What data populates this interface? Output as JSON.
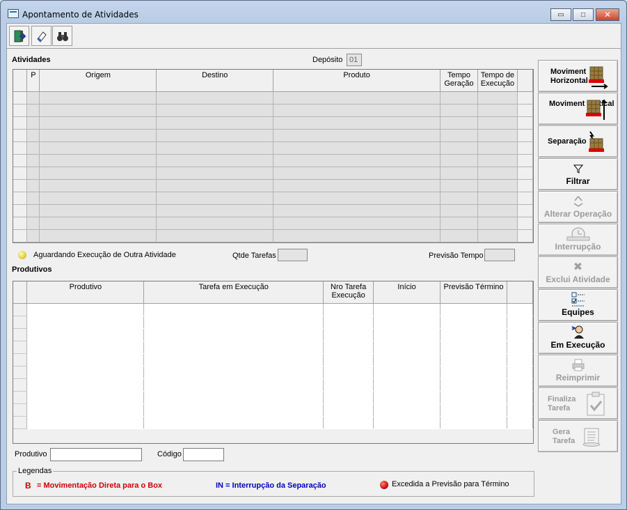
{
  "window": {
    "title": "Apontamento de Atividades",
    "minimize": "▭",
    "maximize": "□",
    "close": "✕"
  },
  "toolbar": {
    "buttons": [
      {
        "icon": "exit-door-icon"
      },
      {
        "icon": "eraser-icon"
      },
      {
        "icon": "binoculars-icon"
      }
    ]
  },
  "atividades": {
    "section_title": "Atividades",
    "deposito_label": "Depósito",
    "deposito_value": "01",
    "columns": [
      "",
      "P",
      "Origem",
      "Destino",
      "Produto",
      "Tempo Geração",
      "Tempo de Execução"
    ],
    "row_count": 12,
    "status_text": "Aguardando Execução de Outra Atividade",
    "status_color": "#e8e05a",
    "qtde_tarefas_label": "Qtde Tarefas",
    "qtde_tarefas_value": "",
    "previsao_tempo_label": "Previsão Tempo",
    "previsao_tempo_value": ""
  },
  "produtivos": {
    "section_title": "Produtivos",
    "columns": [
      "",
      "Produtivo",
      "Tarefa em Execução",
      "Nro Tarefa Execução",
      "Início",
      "Previsão Término",
      ""
    ],
    "row_count": 10,
    "produtivo_label": "Produtivo",
    "produtivo_value": "",
    "codigo_label": "Código",
    "codigo_value": ""
  },
  "side_buttons": [
    {
      "label": "Moviment Horizontal",
      "icon": "pallet-horizontal-icon",
      "enabled": true
    },
    {
      "label": "Moviment Vertical",
      "icon": "pallet-vertical-icon",
      "enabled": true
    },
    {
      "label": "Separação",
      "icon": "pallet-separation-icon",
      "enabled": true
    },
    {
      "label": "Filtrar",
      "icon": "funnel-icon",
      "enabled": true
    },
    {
      "label": "Alterar Operação",
      "icon": "recycle-icon",
      "enabled": false
    },
    {
      "label": "Interrupção",
      "icon": "stopwatch-icon",
      "enabled": false
    },
    {
      "label": "Exclui Atividade",
      "icon": "x-delete-icon",
      "enabled": false
    },
    {
      "label": "Equipes",
      "icon": "checklist-icon",
      "enabled": true
    },
    {
      "label": "Em Execução",
      "icon": "person-gear-icon",
      "enabled": true
    },
    {
      "label": "Reimprimir",
      "icon": "printer-icon",
      "enabled": false
    },
    {
      "label": "Finaliza Tarefa",
      "icon": "clipboard-check-icon",
      "enabled": false
    },
    {
      "label": "Gera Tarefa",
      "icon": "scroll-icon",
      "enabled": false
    }
  ],
  "legend": {
    "title": "Legendas",
    "item1_symbol": "B",
    "item1_text": "= Movimentação Direta para o Box",
    "item1_color": "#d00000",
    "item2_text": "IN = Interrupção da Separação",
    "item2_color": "#0000c0",
    "item3_text": "Excedida a Previsão para Término",
    "item3_color": "#cc1010"
  }
}
